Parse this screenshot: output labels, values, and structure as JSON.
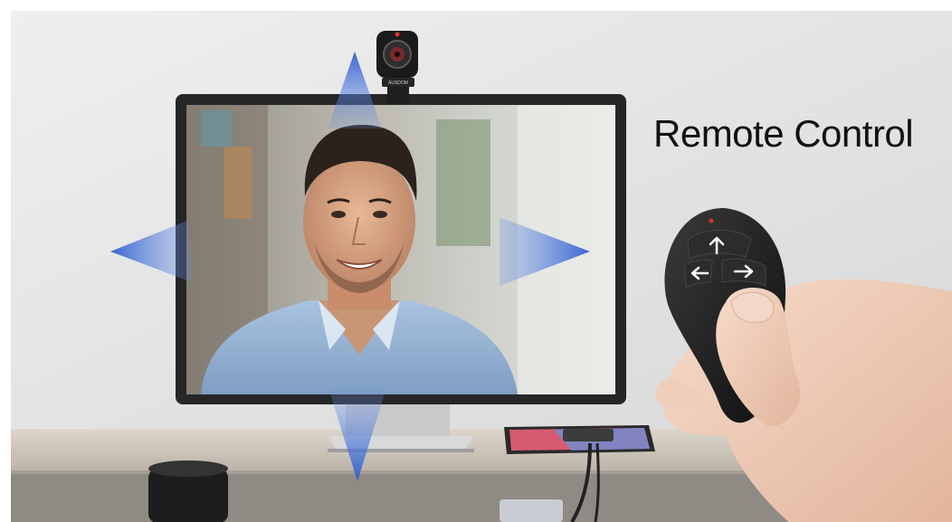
{
  "headline": "Remote Control",
  "webcam": {
    "brand_mark": "AUSDOM"
  },
  "remote": {
    "buttons": [
      "up-arrow",
      "left-arrow",
      "right-arrow"
    ],
    "led_color": "#d9302a"
  },
  "colors": {
    "direction_arrow": "#3a6fd6",
    "remote_body": "#1c1c1c",
    "wall": "#e3e4e4",
    "desk": "#cfc7bb"
  }
}
